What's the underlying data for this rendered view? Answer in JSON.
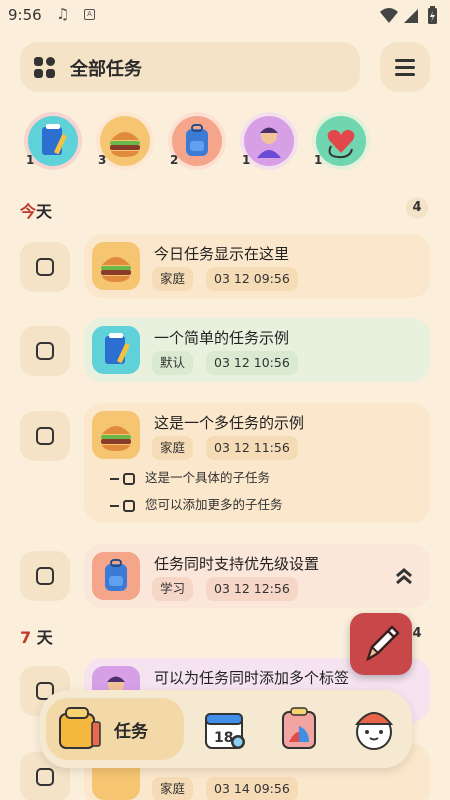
{
  "status_bar": {
    "time": "9:56",
    "a_icon_letter": "A"
  },
  "header": {
    "title": "全部任务",
    "grid_icon": "grid-icon",
    "menu_icon": "menu-icon"
  },
  "categories": [
    {
      "icon": "notebook-pencil-icon",
      "count": "1",
      "color": "#5fd1d8"
    },
    {
      "icon": "burger-icon",
      "count": "3",
      "color": "#f6c572"
    },
    {
      "icon": "backpack-icon",
      "count": "2",
      "color": "#f5a58a"
    },
    {
      "icon": "person-icon",
      "count": "1",
      "color": "#d7a0e6"
    },
    {
      "icon": "heart-stethoscope-icon",
      "count": "1",
      "color": "#6fd6b0"
    }
  ],
  "sections": {
    "today": {
      "first": "今",
      "rest": "天",
      "count": "4"
    },
    "seven_days": {
      "first": "7",
      "rest": " 天",
      "count": "4"
    }
  },
  "tasks": [
    {
      "title": "今日任务显示在这里",
      "tag": "家庭",
      "time": "03 12 09:56",
      "icon": "burger-icon"
    },
    {
      "title": "一个简单的任务示例",
      "tag": "默认",
      "time": "03 12 10:56",
      "icon": "notebook-pencil-icon"
    },
    {
      "title": "这是一个多任务的示例",
      "tag": "家庭",
      "time": "03 12 11:56",
      "icon": "burger-icon",
      "subtasks": [
        "这是一个具体的子任务",
        "您可以添加更多的子任务"
      ]
    },
    {
      "title": "任务同时支持优先级设置",
      "tag": "学习",
      "time": "03 12 12:56",
      "icon": "backpack-icon"
    },
    {
      "title": "可以为任务同时添加多个标签",
      "icon": "person-icon"
    },
    {
      "title": "",
      "tag": "家庭",
      "time": "03 14 09:56",
      "icon": "burger-icon"
    }
  ],
  "fab": {
    "icon": "pencil-icon"
  },
  "bottom_nav": {
    "active_label": "任务",
    "items": [
      "tasks-icon",
      "calendar-icon",
      "stats-icon",
      "profile-icon"
    ],
    "calendar_day": "18"
  },
  "colors": {
    "background": "#fbefdb",
    "accent": "#c0392b",
    "card_default": "#fbe7cb",
    "card_mint": "#e8f1de",
    "card_pink": "#fbe6da",
    "card_lavender": "#f5e3f0"
  }
}
